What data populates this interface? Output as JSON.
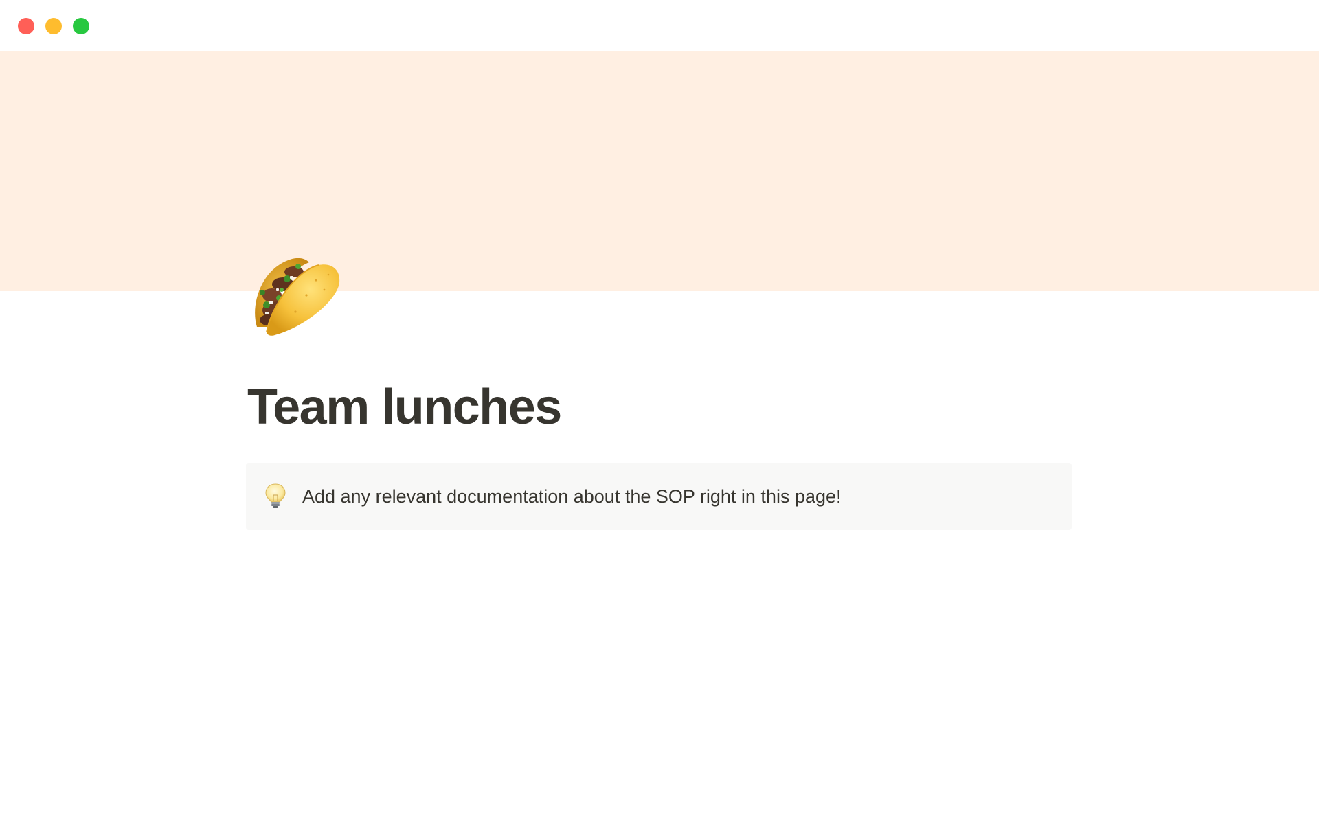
{
  "window": {
    "controls": {
      "close_color": "#ff5f57",
      "minimize_color": "#febc2e",
      "zoom_color": "#28c840"
    }
  },
  "cover": {
    "color": "#ffefe2"
  },
  "page": {
    "icon": "taco-icon",
    "title": "Team lunches"
  },
  "callout": {
    "icon": "light-bulb-icon",
    "text": "Add any relevant documentation about the SOP right in this page!",
    "background": "#f8f8f7"
  }
}
